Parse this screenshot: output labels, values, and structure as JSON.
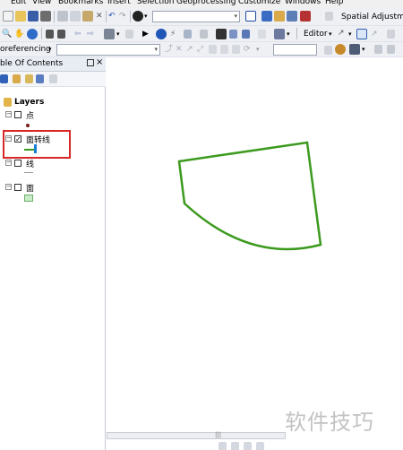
{
  "menu": [
    "Edit",
    "View",
    "Bookmarks",
    "Insert",
    "Selection",
    "Geoprocessing",
    "Customize",
    "Windows",
    "Help"
  ],
  "toolbar": {
    "spatial_adjustment_label": "Spatial Adjustmen",
    "editor_label": "Editor",
    "georeferencing_label": "oreferencing",
    "scale_value": "",
    "layer_dropdown_value": ""
  },
  "toc": {
    "title": "ble Of Contents",
    "close_glyph": "×",
    "root_label": "Layers",
    "layers": [
      {
        "name": "点",
        "checked": false,
        "symbol": "point"
      },
      {
        "name": "面转线",
        "checked": true,
        "symbol": "line"
      },
      {
        "name": "线",
        "checked": false,
        "symbol": "line-thin"
      },
      {
        "name": "面",
        "checked": false,
        "symbol": "polygon"
      }
    ]
  },
  "map": {
    "line_color": "#3c9a1e",
    "symbol_line_color": "#3c9a1e",
    "symbol_marker_color": "#1a7fd6",
    "polygon_fill": "#c9ecc8",
    "highlight_color": "#d92626"
  },
  "watermark": "软件技巧"
}
